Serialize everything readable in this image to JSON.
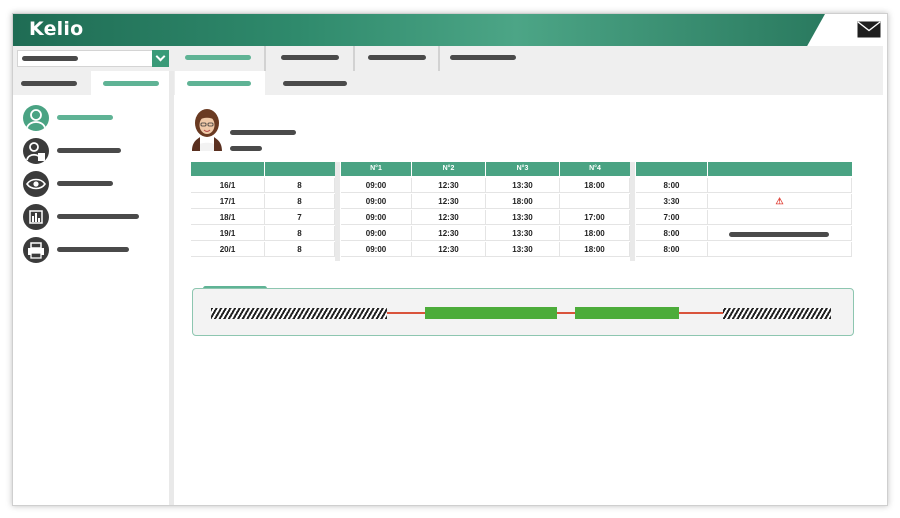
{
  "app": {
    "logo_text": "Kelio",
    "icons": {
      "mail": "mail-icon",
      "select_caret": "chevron-down-icon",
      "nav": [
        "user-circle-icon",
        "user-document-icon",
        "eye-icon",
        "bar-chart-icon",
        "printer-icon"
      ],
      "warning": "warning-icon"
    }
  },
  "colors": {
    "brand_green": "#4aa383",
    "dark_green": "#1f6c54",
    "placeholder_dark": "#4a4a4a",
    "timeline_green": "#4cac3a",
    "timeline_red": "#d9533b",
    "warning": "#e0443a"
  },
  "table": {
    "group1_headers": [
      "",
      ""
    ],
    "group2_headers": [
      "N°1",
      "N°2",
      "N°3",
      "N°4"
    ],
    "group3_headers": [
      "",
      ""
    ],
    "rows": [
      {
        "date": "16/1",
        "hours": "8",
        "n1": "09:00",
        "n2": "12:30",
        "n3": "13:30",
        "n4": "18:00",
        "total": "8:00",
        "warning": ""
      },
      {
        "date": "17/1",
        "hours": "8",
        "n1": "09:00",
        "n2": "12:30",
        "n3": "18:00",
        "n4": "",
        "total": "3:30",
        "warning": "⚠"
      },
      {
        "date": "18/1",
        "hours": "7",
        "n1": "09:00",
        "n2": "12:30",
        "n3": "13:30",
        "n4": "17:00",
        "total": "7:00",
        "warning": ""
      },
      {
        "date": "19/1",
        "hours": "8",
        "n1": "09:00",
        "n2": "12:30",
        "n3": "13:30",
        "n4": "18:00",
        "total": "8:00",
        "warning": ""
      },
      {
        "date": "20/1",
        "hours": "8",
        "n1": "09:00",
        "n2": "12:30",
        "n3": "13:30",
        "n4": "18:00",
        "total": "8:00",
        "warning": ""
      }
    ]
  }
}
